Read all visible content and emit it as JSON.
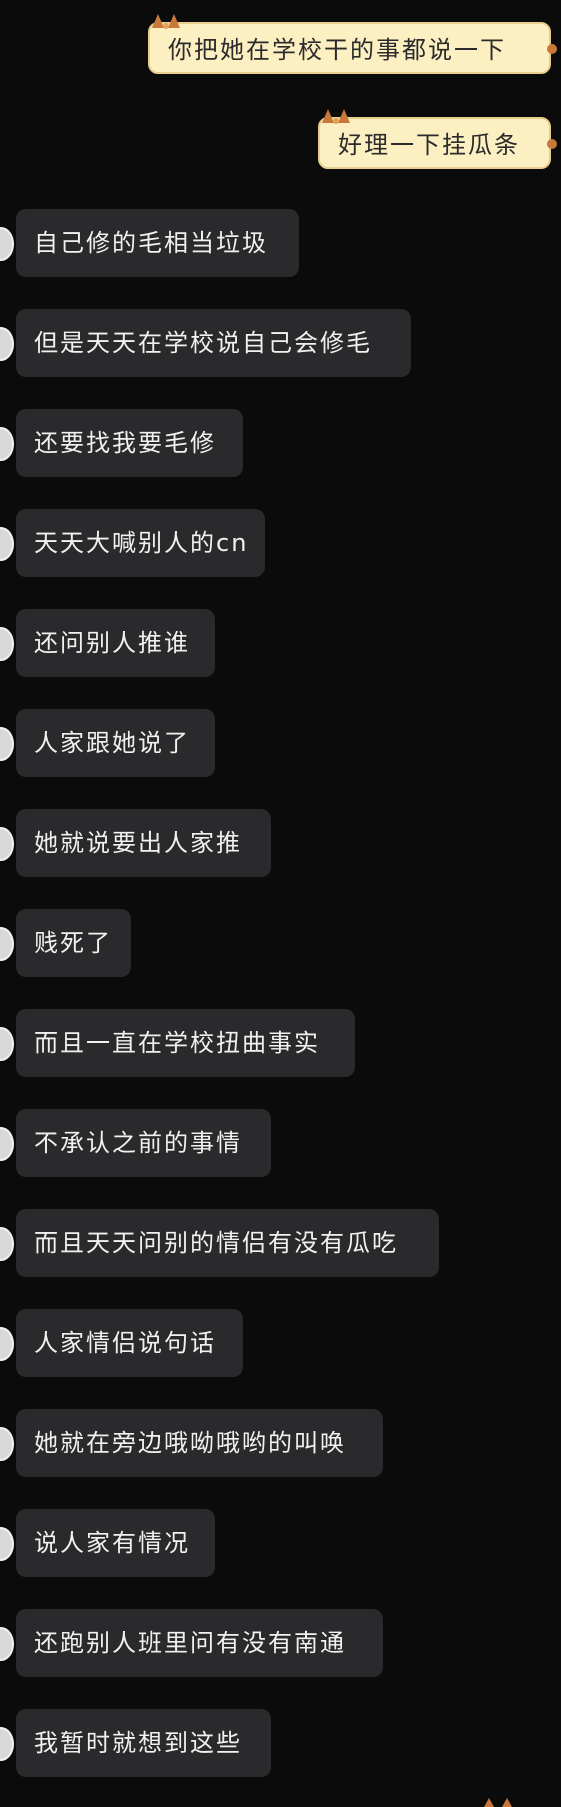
{
  "chat": {
    "sent": [
      {
        "text": "你把她在学校干的事都说一下"
      },
      {
        "text": "好理一下挂瓜条"
      }
    ],
    "received": [
      {
        "text": "自己修的毛相当垃圾"
      },
      {
        "text": "但是天天在学校说自己会修毛"
      },
      {
        "text": "还要找我要毛修"
      },
      {
        "text": "天天大喊别人的cn"
      },
      {
        "text": "还问别人推谁"
      },
      {
        "text": "人家跟她说了"
      },
      {
        "text": "她就说要出人家推"
      },
      {
        "text": "贱死了"
      },
      {
        "text": "而且一直在学校扭曲事实"
      },
      {
        "text": "不承认之前的事情"
      },
      {
        "text": "而且天天问别的情侣有没有瓜吃"
      },
      {
        "text": "人家情侣说句话"
      },
      {
        "text": "她就在旁边哦呦哦哟的叫唤"
      },
      {
        "text": "说人家有情况"
      },
      {
        "text": "还跑别人班里问有没有南通"
      },
      {
        "text": "我暂时就想到这些"
      }
    ]
  },
  "colors": {
    "background": "#0b0b0c",
    "self_bubble": "#fcefc2",
    "self_border": "#e8cf8e",
    "other_bubble": "#2a2a2c",
    "other_text": "#f1f1f1"
  },
  "icons": [
    "cat-ears-icon",
    "avatar-icon"
  ]
}
